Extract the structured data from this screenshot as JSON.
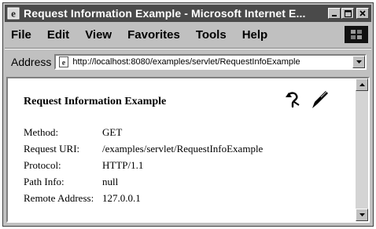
{
  "window": {
    "title": "Request Information Example - Microsoft Internet E..."
  },
  "menu": [
    "File",
    "Edit",
    "View",
    "Favorites",
    "Tools",
    "Help"
  ],
  "address": {
    "label": "Address",
    "url": "http://localhost:8080/examples/servlet/RequestInfoExample"
  },
  "page": {
    "heading": "Request Information Example",
    "rows": [
      {
        "key": "Method:",
        "value": "GET"
      },
      {
        "key": "Request URI:",
        "value": "/examples/servlet/RequestInfoExample"
      },
      {
        "key": "Protocol:",
        "value": "HTTP/1.1"
      },
      {
        "key": "Path Info:",
        "value": "null"
      },
      {
        "key": "Remote Address:",
        "value": "127.0.0.1"
      }
    ]
  },
  "icons": {
    "title_icon": "internet-explorer-icon",
    "back": "return-arrow-icon",
    "source": "quill-pen-icon"
  }
}
